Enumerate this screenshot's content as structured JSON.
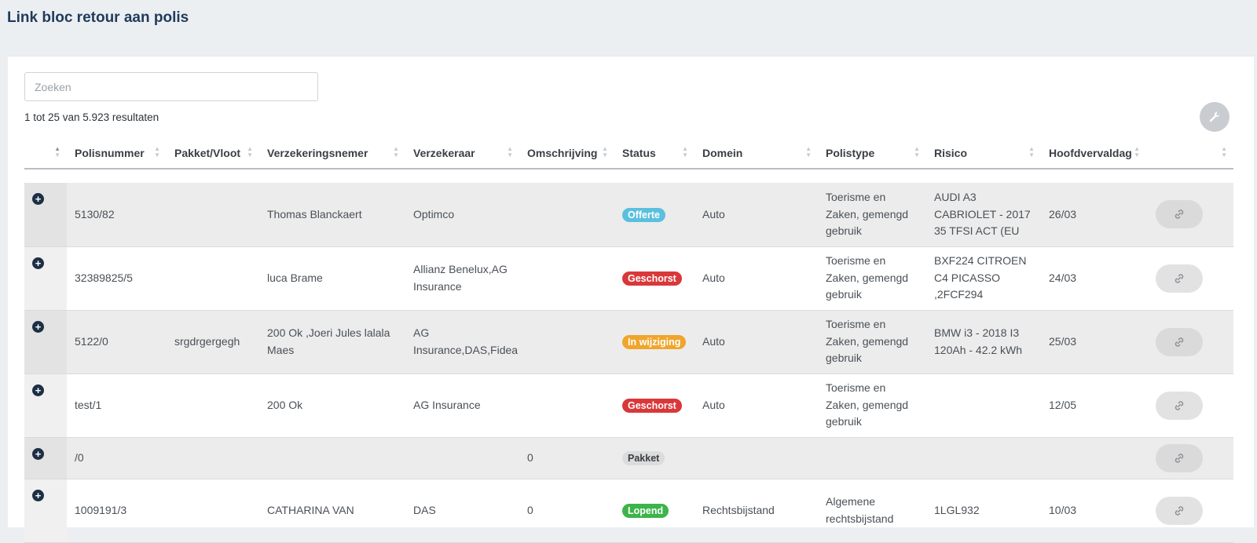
{
  "page": {
    "title": "Link bloc retour aan polis"
  },
  "search": {
    "placeholder": "Zoeken",
    "value": ""
  },
  "results_text": "1 tot 25 van 5.923 resultaten",
  "columns": [
    "",
    "Polisnummer",
    "Pakket/Vloot",
    "Verzekeringsnemer",
    "Verzekeraar",
    "Omschrijving",
    "Status",
    "Domein",
    "Polistype",
    "Risico",
    "Hoofdvervaldag",
    ""
  ],
  "status_colors": {
    "Offerte": "#5bc0de",
    "Geschorst": "#d9383a",
    "In wijziging": "#f0a52c",
    "Pakket": "#dcdcdc",
    "Lopend": "#3cb44a"
  },
  "rows": [
    {
      "polisnummer": "5130/82",
      "pakket": "",
      "nemer": "Thomas Blanckaert",
      "verzekeraar": "Optimco",
      "omschrijving": "",
      "status": "Offerte",
      "domein": "Auto",
      "polistype": "Toerisme en Zaken, gemengd gebruik",
      "risico": "AUDI A3 CABRIOLET - 2017 35 TFSI ACT (EU",
      "vervaldag": "26/03"
    },
    {
      "polisnummer": "32389825/5",
      "pakket": "",
      "nemer": "luca Brame",
      "verzekeraar": "Allianz Benelux,AG Insurance",
      "omschrijving": "",
      "status": "Geschorst",
      "domein": "Auto",
      "polistype": "Toerisme en Zaken, gemengd gebruik",
      "risico": "BXF224 CITROEN C4 PICASSO ,2FCF294",
      "vervaldag": "24/03"
    },
    {
      "polisnummer": "5122/0",
      "pakket": "srgdrgergegh",
      "nemer": "200 Ok ,Joeri Jules lalala Maes",
      "verzekeraar": "AG Insurance,DAS,Fidea",
      "omschrijving": "",
      "status": "In wijziging",
      "domein": "Auto",
      "polistype": "Toerisme en Zaken, gemengd gebruik",
      "risico": "BMW i3 - 2018 I3 120Ah - 42.2 kWh",
      "vervaldag": "25/03"
    },
    {
      "polisnummer": "test/1",
      "pakket": "",
      "nemer": "200 Ok",
      "verzekeraar": "AG Insurance",
      "omschrijving": "",
      "status": "Geschorst",
      "domein": "Auto",
      "polistype": "Toerisme en Zaken, gemengd gebruik",
      "risico": "",
      "vervaldag": "12/05"
    },
    {
      "polisnummer": "/0",
      "pakket": "",
      "nemer": "",
      "verzekeraar": "",
      "omschrijving": "0",
      "status": "Pakket",
      "domein": "",
      "polistype": "",
      "risico": "",
      "vervaldag": ""
    },
    {
      "polisnummer": "1009191/3",
      "pakket": "",
      "nemer": "CATHARINA VAN",
      "verzekeraar": "DAS",
      "omschrijving": "0",
      "status": "Lopend",
      "domein": "Rechtsbijstand",
      "polistype": "Algemene rechtsbijstand",
      "risico": "1LGL932",
      "vervaldag": "10/03"
    }
  ]
}
